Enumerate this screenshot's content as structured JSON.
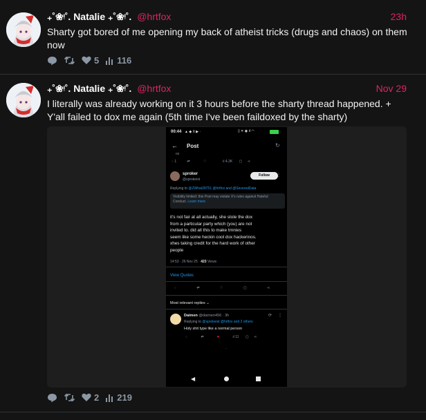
{
  "tweets": [
    {
      "display_name": "₊˚❀ᵎ˚. Natalie ₊˚❀ᵎ˚.",
      "handle": "@hrtfox",
      "time": "23h",
      "text": "Sharty got bored of me opening my back of atheist tricks (drugs and chaos) on them now",
      "likes": "5",
      "views": "116"
    },
    {
      "display_name": "₊˚❀ᵎ˚. Natalie ₊˚❀ᵎ˚.",
      "handle": "@hrtfox",
      "time": "Nov 29",
      "text": "I literally was already working on it 3 hours before the sharty thread happened. + Y'all failed to dox me again (5th time I've been faildoxed by the sharty)",
      "likes": "2",
      "views": "219"
    }
  ],
  "icons": [
    "reply-icon",
    "retweet-icon",
    "heart-icon",
    "views-icon"
  ],
  "colors": {
    "background": "#141414",
    "accent": "#e0245e",
    "phone_link": "#1d9bf0"
  },
  "screenshot": {
    "status_time": "00:44",
    "header_title": "Post",
    "prev_views": "4.2K",
    "reply_user": "sproker",
    "reply_handle": "@sprokeist",
    "follow_label": "Follow",
    "replying_to_prefix": "Replying to",
    "replying_to_users": "@ZWhat28751 @hrtfox and @SeveredData",
    "visibility_notice": "Visibility limited: this Post may violate X's rules against Hateful Conduct.",
    "learn_more": "Learn more",
    "body_lines": [
      "it's not fair at all actually, she stole the dox",
      "from a particular party which (you) are not",
      "invited to. did all this to make tr​nnies",
      "seem like some heckin cool dox hackerinos.",
      "xhes taking credit for the hard work of other",
      "people"
    ],
    "timestamp": "14:53 · 26 Nov 25 ·",
    "views_count": "423",
    "views_label": "Views",
    "view_quotes": "View Quotes",
    "most_relevant": "Most relevant replies",
    "reply2_user": "Daimen",
    "reply2_handle": "@daimen456 · 3h",
    "reply2_replying_prefix": "Replying to",
    "reply2_replying": "@sprokeist @hrtfox and 2 others",
    "reply2_text": "Holy shit type like a normal person",
    "reply2_views": "11"
  }
}
